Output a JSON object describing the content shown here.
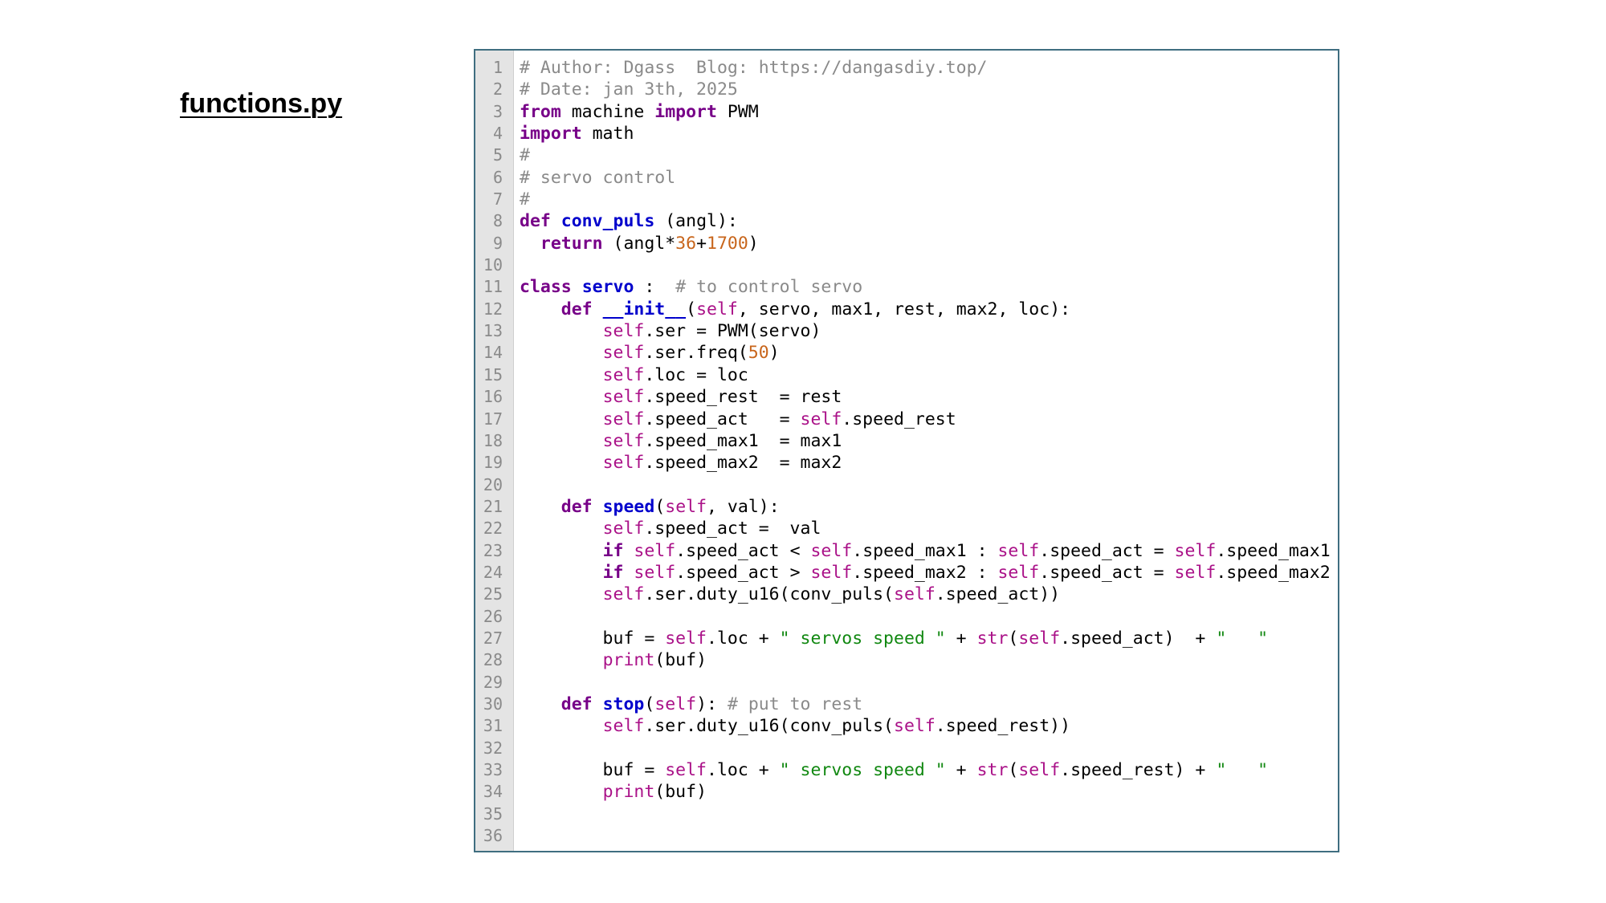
{
  "title": "functions.py",
  "colors": {
    "keyword": "#770088",
    "function_name": "#0000cc",
    "self": "#aa1188",
    "number": "#c8651b",
    "string": "#118811",
    "comment": "#8a8a8a",
    "panel_border": "#3f6e80",
    "gutter": "#e4e4e4"
  },
  "code": {
    "lines": [
      [
        {
          "t": "com",
          "s": "# Author: Dgass  Blog: https://dangasdiy.top/"
        }
      ],
      [
        {
          "t": "com",
          "s": "# Date: jan 3th, 2025"
        }
      ],
      [
        {
          "t": "kw",
          "s": "from"
        },
        {
          "t": "txt",
          "s": " machine "
        },
        {
          "t": "kw",
          "s": "import"
        },
        {
          "t": "txt",
          "s": " PWM"
        }
      ],
      [
        {
          "t": "kw",
          "s": "import"
        },
        {
          "t": "txt",
          "s": " math"
        }
      ],
      [
        {
          "t": "com",
          "s": "#"
        }
      ],
      [
        {
          "t": "com",
          "s": "# servo control"
        }
      ],
      [
        {
          "t": "com",
          "s": "#"
        }
      ],
      [
        {
          "t": "kw",
          "s": "def"
        },
        {
          "t": "txt",
          "s": " "
        },
        {
          "t": "fn",
          "s": "conv_puls"
        },
        {
          "t": "txt",
          "s": " (angl):"
        }
      ],
      [
        {
          "t": "txt",
          "s": "  "
        },
        {
          "t": "kw",
          "s": "return"
        },
        {
          "t": "txt",
          "s": " (angl*"
        },
        {
          "t": "num",
          "s": "36"
        },
        {
          "t": "txt",
          "s": "+"
        },
        {
          "t": "num",
          "s": "1700"
        },
        {
          "t": "txt",
          "s": ")"
        }
      ],
      [],
      [
        {
          "t": "kw",
          "s": "class"
        },
        {
          "t": "txt",
          "s": " "
        },
        {
          "t": "fn",
          "s": "servo"
        },
        {
          "t": "txt",
          "s": " :  "
        },
        {
          "t": "com",
          "s": "# to control servo"
        }
      ],
      [
        {
          "t": "txt",
          "s": "    "
        },
        {
          "t": "kw",
          "s": "def"
        },
        {
          "t": "txt",
          "s": " "
        },
        {
          "t": "fn",
          "s": "__init__"
        },
        {
          "t": "txt",
          "s": "("
        },
        {
          "t": "self",
          "s": "self"
        },
        {
          "t": "txt",
          "s": ", servo, max1, rest, max2, loc):"
        }
      ],
      [
        {
          "t": "txt",
          "s": "        "
        },
        {
          "t": "self",
          "s": "self"
        },
        {
          "t": "txt",
          "s": ".ser = PWM(servo)"
        }
      ],
      [
        {
          "t": "txt",
          "s": "        "
        },
        {
          "t": "self",
          "s": "self"
        },
        {
          "t": "txt",
          "s": ".ser.freq("
        },
        {
          "t": "num",
          "s": "50"
        },
        {
          "t": "txt",
          "s": ")"
        }
      ],
      [
        {
          "t": "txt",
          "s": "        "
        },
        {
          "t": "self",
          "s": "self"
        },
        {
          "t": "txt",
          "s": ".loc = loc"
        }
      ],
      [
        {
          "t": "txt",
          "s": "        "
        },
        {
          "t": "self",
          "s": "self"
        },
        {
          "t": "txt",
          "s": ".speed_rest  = rest"
        }
      ],
      [
        {
          "t": "txt",
          "s": "        "
        },
        {
          "t": "self",
          "s": "self"
        },
        {
          "t": "txt",
          "s": ".speed_act   = "
        },
        {
          "t": "self",
          "s": "self"
        },
        {
          "t": "txt",
          "s": ".speed_rest"
        }
      ],
      [
        {
          "t": "txt",
          "s": "        "
        },
        {
          "t": "self",
          "s": "self"
        },
        {
          "t": "txt",
          "s": ".speed_max1  = max1"
        }
      ],
      [
        {
          "t": "txt",
          "s": "        "
        },
        {
          "t": "self",
          "s": "self"
        },
        {
          "t": "txt",
          "s": ".speed_max2  = max2"
        }
      ],
      [],
      [
        {
          "t": "txt",
          "s": "    "
        },
        {
          "t": "kw",
          "s": "def"
        },
        {
          "t": "txt",
          "s": " "
        },
        {
          "t": "fn",
          "s": "speed"
        },
        {
          "t": "txt",
          "s": "("
        },
        {
          "t": "self",
          "s": "self"
        },
        {
          "t": "txt",
          "s": ", val):"
        }
      ],
      [
        {
          "t": "txt",
          "s": "        "
        },
        {
          "t": "self",
          "s": "self"
        },
        {
          "t": "txt",
          "s": ".speed_act =  val"
        }
      ],
      [
        {
          "t": "txt",
          "s": "        "
        },
        {
          "t": "kw",
          "s": "if"
        },
        {
          "t": "txt",
          "s": " "
        },
        {
          "t": "self",
          "s": "self"
        },
        {
          "t": "txt",
          "s": ".speed_act < "
        },
        {
          "t": "self",
          "s": "self"
        },
        {
          "t": "txt",
          "s": ".speed_max1 : "
        },
        {
          "t": "self",
          "s": "self"
        },
        {
          "t": "txt",
          "s": ".speed_act = "
        },
        {
          "t": "self",
          "s": "self"
        },
        {
          "t": "txt",
          "s": ".speed_max1"
        }
      ],
      [
        {
          "t": "txt",
          "s": "        "
        },
        {
          "t": "kw",
          "s": "if"
        },
        {
          "t": "txt",
          "s": " "
        },
        {
          "t": "self",
          "s": "self"
        },
        {
          "t": "txt",
          "s": ".speed_act > "
        },
        {
          "t": "self",
          "s": "self"
        },
        {
          "t": "txt",
          "s": ".speed_max2 : "
        },
        {
          "t": "self",
          "s": "self"
        },
        {
          "t": "txt",
          "s": ".speed_act = "
        },
        {
          "t": "self",
          "s": "self"
        },
        {
          "t": "txt",
          "s": ".speed_max2"
        }
      ],
      [
        {
          "t": "txt",
          "s": "        "
        },
        {
          "t": "self",
          "s": "self"
        },
        {
          "t": "txt",
          "s": ".ser.duty_u16(conv_puls("
        },
        {
          "t": "self",
          "s": "self"
        },
        {
          "t": "txt",
          "s": ".speed_act))"
        }
      ],
      [],
      [
        {
          "t": "txt",
          "s": "        buf = "
        },
        {
          "t": "self",
          "s": "self"
        },
        {
          "t": "txt",
          "s": ".loc + "
        },
        {
          "t": "str",
          "s": "\" servos speed \""
        },
        {
          "t": "txt",
          "s": " + "
        },
        {
          "t": "bi",
          "s": "str"
        },
        {
          "t": "txt",
          "s": "("
        },
        {
          "t": "self",
          "s": "self"
        },
        {
          "t": "txt",
          "s": ".speed_act)  + "
        },
        {
          "t": "str",
          "s": "\"   \""
        }
      ],
      [
        {
          "t": "txt",
          "s": "        "
        },
        {
          "t": "bi",
          "s": "print"
        },
        {
          "t": "txt",
          "s": "(buf)"
        }
      ],
      [],
      [
        {
          "t": "txt",
          "s": "    "
        },
        {
          "t": "kw",
          "s": "def"
        },
        {
          "t": "txt",
          "s": " "
        },
        {
          "t": "fn",
          "s": "stop"
        },
        {
          "t": "txt",
          "s": "("
        },
        {
          "t": "self",
          "s": "self"
        },
        {
          "t": "txt",
          "s": "): "
        },
        {
          "t": "com",
          "s": "# put to rest"
        }
      ],
      [
        {
          "t": "txt",
          "s": "        "
        },
        {
          "t": "self",
          "s": "self"
        },
        {
          "t": "txt",
          "s": ".ser.duty_u16(conv_puls("
        },
        {
          "t": "self",
          "s": "self"
        },
        {
          "t": "txt",
          "s": ".speed_rest))"
        }
      ],
      [],
      [
        {
          "t": "txt",
          "s": "        buf = "
        },
        {
          "t": "self",
          "s": "self"
        },
        {
          "t": "txt",
          "s": ".loc + "
        },
        {
          "t": "str",
          "s": "\" servos speed \""
        },
        {
          "t": "txt",
          "s": " + "
        },
        {
          "t": "bi",
          "s": "str"
        },
        {
          "t": "txt",
          "s": "("
        },
        {
          "t": "self",
          "s": "self"
        },
        {
          "t": "txt",
          "s": ".speed_rest) + "
        },
        {
          "t": "str",
          "s": "\"   \""
        }
      ],
      [
        {
          "t": "txt",
          "s": "        "
        },
        {
          "t": "bi",
          "s": "print"
        },
        {
          "t": "txt",
          "s": "(buf)"
        }
      ],
      [],
      []
    ]
  }
}
